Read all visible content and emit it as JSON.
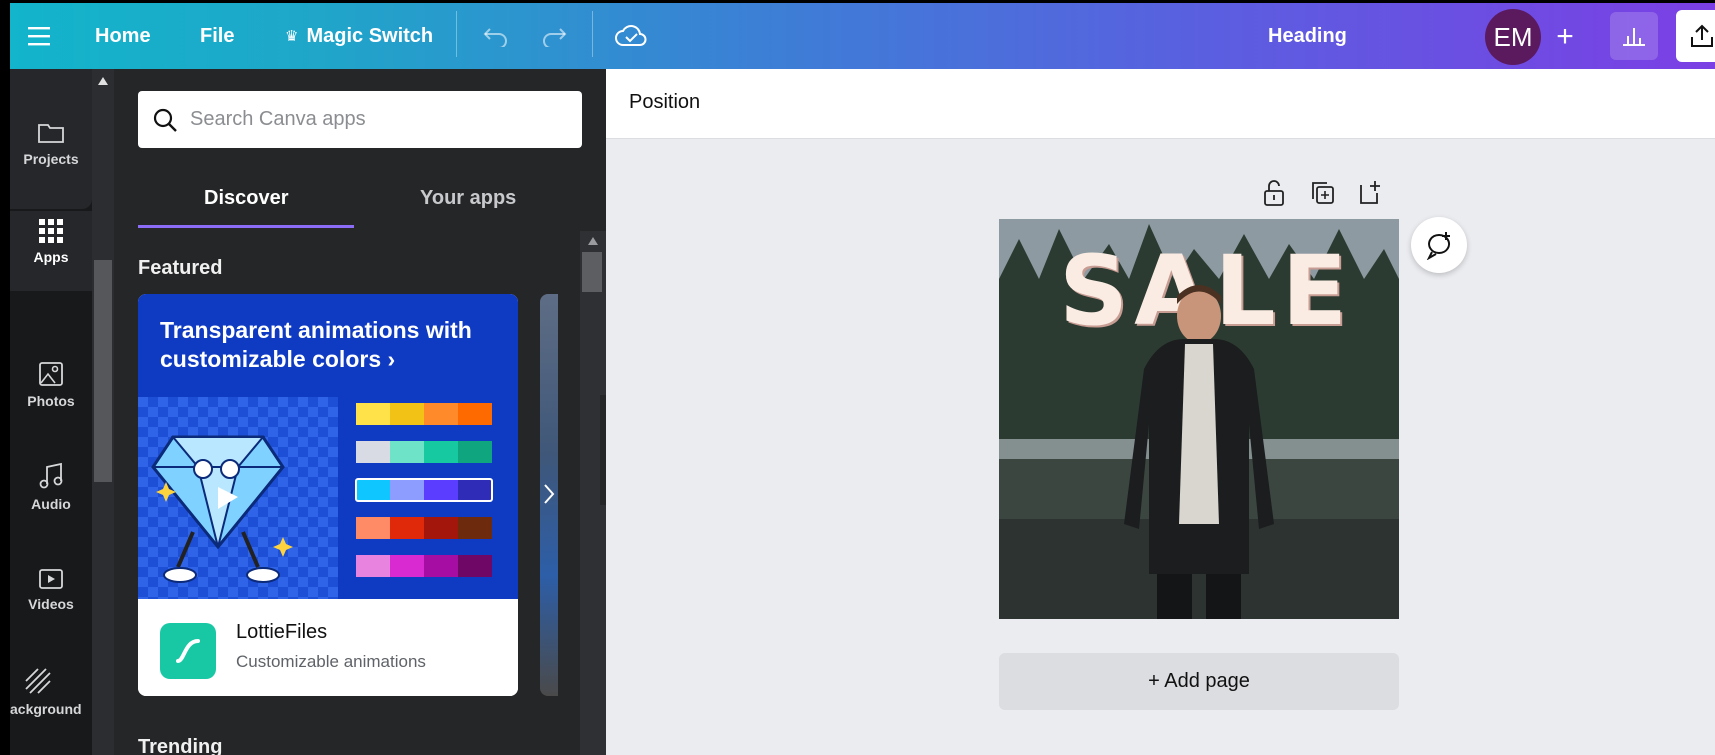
{
  "topbar": {
    "menu_icon": "hamburger-icon",
    "home": "Home",
    "file": "File",
    "magic_switch": "Magic Switch",
    "magic_icon": "crown-sparkle-icon",
    "title": "Heading",
    "avatar_initials": "EM",
    "add": "+"
  },
  "rail": {
    "items": [
      {
        "label": "Projects",
        "icon": "folder-icon"
      },
      {
        "label": "Apps",
        "icon": "apps-grid-icon"
      },
      {
        "label": "Photos",
        "icon": "photo-icon"
      },
      {
        "label": "Audio",
        "icon": "music-note-icon"
      },
      {
        "label": "Videos",
        "icon": "video-icon"
      },
      {
        "label": "ackground",
        "icon": "background-pattern-icon"
      }
    ]
  },
  "panel": {
    "search_placeholder": "Search Canva apps",
    "tabs": [
      {
        "label": "Discover",
        "active": true
      },
      {
        "label": "Your apps",
        "active": false
      }
    ],
    "featured_title": "Featured",
    "featured_card": {
      "headline": "Transparent animations with customizable colors ›",
      "app_name": "LottieFiles",
      "app_desc": "Customizable animations"
    },
    "trending_title": "Trending"
  },
  "workspace": {
    "context_label": "Position",
    "design_text": "SALE",
    "add_page": "+ Add page"
  },
  "colors": {
    "accent_tab": "#8b6cf7",
    "hero_blue": "#0f3ac2",
    "lottie_green": "#18c8a4",
    "avatar": "#5b1a5e"
  }
}
